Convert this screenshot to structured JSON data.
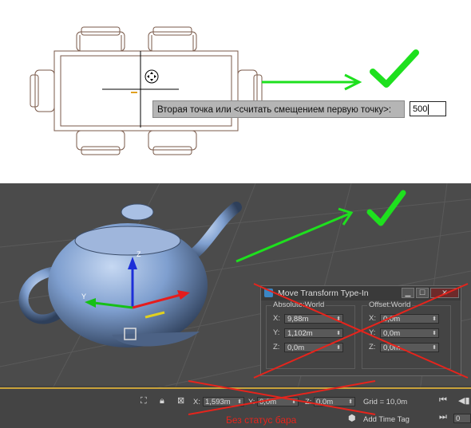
{
  "top_panel": {
    "command_prompt": "Вторая точка или <считать смещением первую точку>:",
    "command_value": "500"
  },
  "dialog": {
    "title": "Move Transform Type-In",
    "minimize_label": "▁",
    "restore_label": "☐",
    "close_label": "✕",
    "absolute": {
      "label": "Absolute:World",
      "x": {
        "axis": "X:",
        "value": "9,88m"
      },
      "y": {
        "axis": "Y:",
        "value": "1,102m"
      },
      "z": {
        "axis": "Z:",
        "value": "0,0m"
      }
    },
    "offset": {
      "label": "Offset:World",
      "x": {
        "axis": "X:",
        "value": "0,0m"
      },
      "y": {
        "axis": "Y:",
        "value": "0,0m"
      },
      "z": {
        "axis": "Z:",
        "value": "0,0m"
      }
    }
  },
  "status_bar": {
    "x_label": "X:",
    "x_value": "1,593m",
    "y_label": "Y:",
    "y_value": "0,0m",
    "z_label": "Z:",
    "z_value": "0,0m",
    "grid_text": "Grid = 10,0m",
    "add_time_tag": "Add Time Tag",
    "frame_value": "0",
    "caption": "Без статус бара"
  },
  "colors": {
    "check_green": "#1ee01e",
    "cross_red": "#e6241c",
    "viewport_bg": "#4b4b4b",
    "teapot_blue": "#7f9fcf"
  }
}
